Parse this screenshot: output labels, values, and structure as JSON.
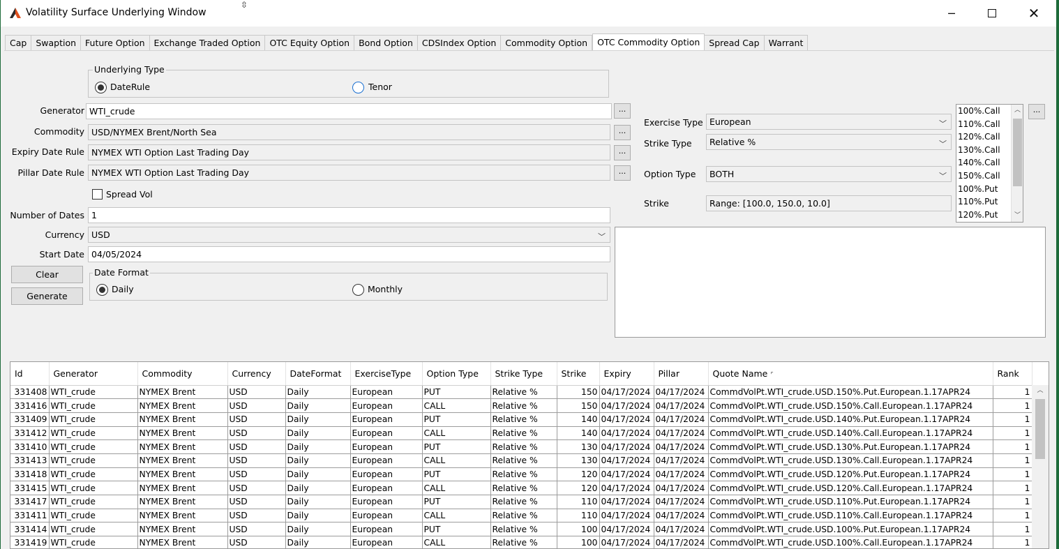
{
  "window": {
    "title": "Volatility Surface Underlying Window"
  },
  "tabs": [
    "Cap",
    "Swaption",
    "Future Option",
    "Exchange Traded Option",
    "OTC Equity Option",
    "Bond Option",
    "CDSIndex Option",
    "Commodity Option",
    "OTC Commodity Option",
    "Spread Cap",
    "Warrant"
  ],
  "active_tab": "OTC Commodity Option",
  "underlying_type": {
    "title": "Underlying Type",
    "options": [
      "DateRule",
      "Tenor"
    ],
    "selected": "DateRule"
  },
  "form": {
    "generator_label": "Generator",
    "generator_value": "WTI_crude",
    "commodity_label": "Commodity",
    "commodity_value": "USD/NYMEX Brent/North Sea",
    "expiry_label": "Expiry Date Rule",
    "expiry_value": "NYMEX WTI Option Last Trading Day",
    "pillar_label": "Pillar Date Rule",
    "pillar_value": "NYMEX WTI Option Last Trading Day",
    "spread_vol_label": "Spread Vol",
    "spread_vol_checked": false,
    "num_dates_label": "Number of Dates",
    "num_dates_value": "1",
    "currency_label": "Currency",
    "currency_value": "USD",
    "start_date_label": "Start Date",
    "start_date_value": "04/05/2024",
    "dots": "..."
  },
  "buttons": {
    "clear": "Clear",
    "generate": "Generate"
  },
  "date_format": {
    "title": "Date Format",
    "options": [
      "Daily",
      "Monthly"
    ],
    "selected": "Daily"
  },
  "right_panel": {
    "exercise_label": "Exercise Type",
    "exercise_value": "European",
    "strike_type_label": "Strike Type",
    "strike_type_value": "Relative %",
    "option_type_label": "Option Type",
    "option_type_value": "BOTH",
    "strike_label": "Strike",
    "strike_value": "Range: [100.0, 150.0, 10.0]",
    "list_items": [
      "100%.Call",
      "110%.Call",
      "120%.Call",
      "130%.Call",
      "140%.Call",
      "150%.Call",
      "100%.Put",
      "110%.Put",
      "120%.Put"
    ]
  },
  "table": {
    "columns": [
      "Id",
      "Generator",
      "Commodity",
      "Currency",
      "DateFormat",
      "ExerciseType",
      "Option Type",
      "Strike Type",
      "Strike",
      "Expiry",
      "Pillar",
      "Quote Name",
      "Rank"
    ],
    "rows": [
      [
        "331408",
        "WTI_crude",
        "NYMEX Brent",
        "USD",
        "Daily",
        "European",
        "PUT",
        "Relative %",
        "150",
        "04/17/2024",
        "04/17/2024",
        "CommdVolPt.WTI_crude.USD.150%.Put.European.1.17APR24",
        "1"
      ],
      [
        "331416",
        "WTI_crude",
        "NYMEX Brent",
        "USD",
        "Daily",
        "European",
        "CALL",
        "Relative %",
        "150",
        "04/17/2024",
        "04/17/2024",
        "CommdVolPt.WTI_crude.USD.150%.Call.European.1.17APR24",
        "1"
      ],
      [
        "331409",
        "WTI_crude",
        "NYMEX Brent",
        "USD",
        "Daily",
        "European",
        "PUT",
        "Relative %",
        "140",
        "04/17/2024",
        "04/17/2024",
        "CommdVolPt.WTI_crude.USD.140%.Put.European.1.17APR24",
        "1"
      ],
      [
        "331412",
        "WTI_crude",
        "NYMEX Brent",
        "USD",
        "Daily",
        "European",
        "CALL",
        "Relative %",
        "140",
        "04/17/2024",
        "04/17/2024",
        "CommdVolPt.WTI_crude.USD.140%.Call.European.1.17APR24",
        "1"
      ],
      [
        "331410",
        "WTI_crude",
        "NYMEX Brent",
        "USD",
        "Daily",
        "European",
        "PUT",
        "Relative %",
        "130",
        "04/17/2024",
        "04/17/2024",
        "CommdVolPt.WTI_crude.USD.130%.Put.European.1.17APR24",
        "1"
      ],
      [
        "331413",
        "WTI_crude",
        "NYMEX Brent",
        "USD",
        "Daily",
        "European",
        "CALL",
        "Relative %",
        "130",
        "04/17/2024",
        "04/17/2024",
        "CommdVolPt.WTI_crude.USD.130%.Call.European.1.17APR24",
        "1"
      ],
      [
        "331418",
        "WTI_crude",
        "NYMEX Brent",
        "USD",
        "Daily",
        "European",
        "PUT",
        "Relative %",
        "120",
        "04/17/2024",
        "04/17/2024",
        "CommdVolPt.WTI_crude.USD.120%.Put.European.1.17APR24",
        "1"
      ],
      [
        "331415",
        "WTI_crude",
        "NYMEX Brent",
        "USD",
        "Daily",
        "European",
        "CALL",
        "Relative %",
        "120",
        "04/17/2024",
        "04/17/2024",
        "CommdVolPt.WTI_crude.USD.120%.Call.European.1.17APR24",
        "1"
      ],
      [
        "331417",
        "WTI_crude",
        "NYMEX Brent",
        "USD",
        "Daily",
        "European",
        "PUT",
        "Relative %",
        "110",
        "04/17/2024",
        "04/17/2024",
        "CommdVolPt.WTI_crude.USD.110%.Put.European.1.17APR24",
        "1"
      ],
      [
        "331411",
        "WTI_crude",
        "NYMEX Brent",
        "USD",
        "Daily",
        "European",
        "CALL",
        "Relative %",
        "110",
        "04/17/2024",
        "04/17/2024",
        "CommdVolPt.WTI_crude.USD.110%.Call.European.1.17APR24",
        "1"
      ],
      [
        "331414",
        "WTI_crude",
        "NYMEX Brent",
        "USD",
        "Daily",
        "European",
        "PUT",
        "Relative %",
        "100",
        "04/17/2024",
        "04/17/2024",
        "CommdVolPt.WTI_crude.USD.100%.Put.European.1.17APR24",
        "1"
      ],
      [
        "331419",
        "WTI_crude",
        "NYMEX Brent",
        "USD",
        "Daily",
        "European",
        "CALL",
        "Relative %",
        "100",
        "04/17/2024",
        "04/17/2024",
        "CommdVolPt.WTI_crude.USD.100%.Call.European.1.17APR24",
        "1"
      ]
    ]
  },
  "colors": {
    "brand_logo": "#e0501e",
    "desktop": "#1e6b3a",
    "radio_accent": "#1a6fd1"
  }
}
